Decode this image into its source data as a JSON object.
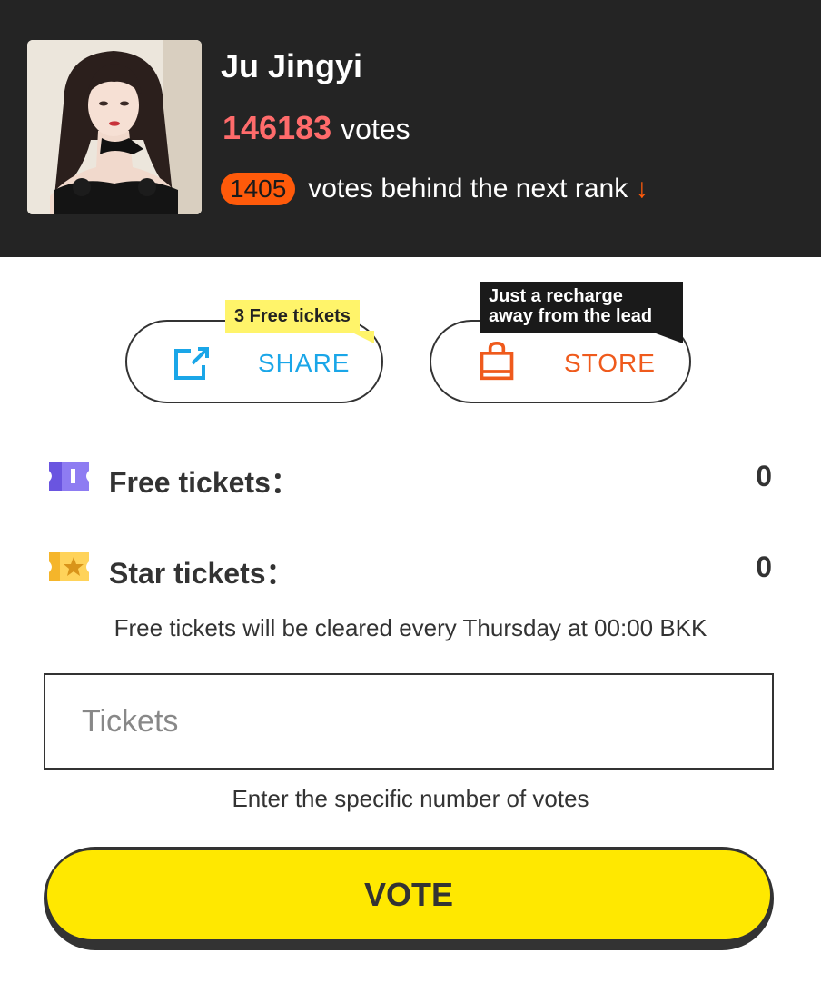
{
  "profile": {
    "name": "Ju Jingyi",
    "votes": "146183",
    "votes_suffix": "votes",
    "behind": "1405",
    "behind_text": "votes behind the next rank",
    "rank_arrow": "↓"
  },
  "actions": {
    "share_label": "SHARE",
    "share_tag": "3 Free tickets",
    "store_label": "STORE",
    "store_tag_line1": "Just a recharge",
    "store_tag_line2": "away from the lead"
  },
  "tickets": {
    "free_label": "Free tickets：",
    "free_value": "0",
    "star_label": "Star tickets：",
    "star_value": "0",
    "note": "Free tickets will be cleared every Thursday at 00:00 BKK"
  },
  "input": {
    "placeholder": "Tickets",
    "hint": "Enter the specific number of votes"
  },
  "vote_button": "VOTE",
  "colors": {
    "header_bg": "#242424",
    "votes_accent": "#ff6b6b",
    "behind_badge": "#ff5a0a",
    "share_blue": "#1aa6e8",
    "store_orange": "#ef5a1c",
    "vote_yellow": "#ffe800"
  },
  "icons": {
    "share": "share-icon",
    "store": "shopping-bag-icon",
    "free_ticket": "free-ticket-icon",
    "star_ticket": "star-ticket-icon"
  }
}
